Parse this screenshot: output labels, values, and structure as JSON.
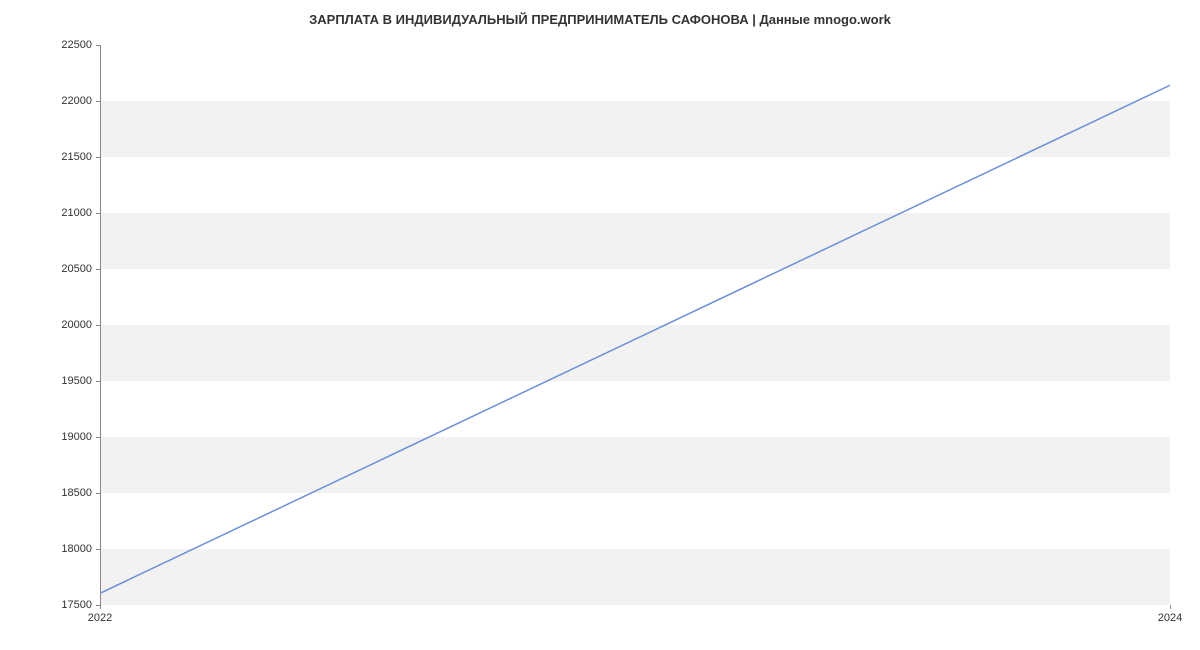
{
  "chart_data": {
    "type": "line",
    "title": "ЗАРПЛАТА В ИНДИВИДУАЛЬНЫЙ ПРЕДПРИНИМАТЕЛЬ САФОНОВА | Данные mnogo.work",
    "x": [
      2022,
      2024
    ],
    "values": [
      17600,
      22140
    ],
    "xlabel": "",
    "ylabel": "",
    "xlim": [
      2022,
      2024
    ],
    "ylim": [
      17500,
      22500
    ],
    "x_ticks": [
      2022,
      2024
    ],
    "y_ticks": [
      17500,
      18000,
      18500,
      19000,
      19500,
      20000,
      20500,
      21000,
      21500,
      22000,
      22500
    ],
    "line_color": "#6a8fd8",
    "grid_band_color": "#f2f2f2"
  }
}
